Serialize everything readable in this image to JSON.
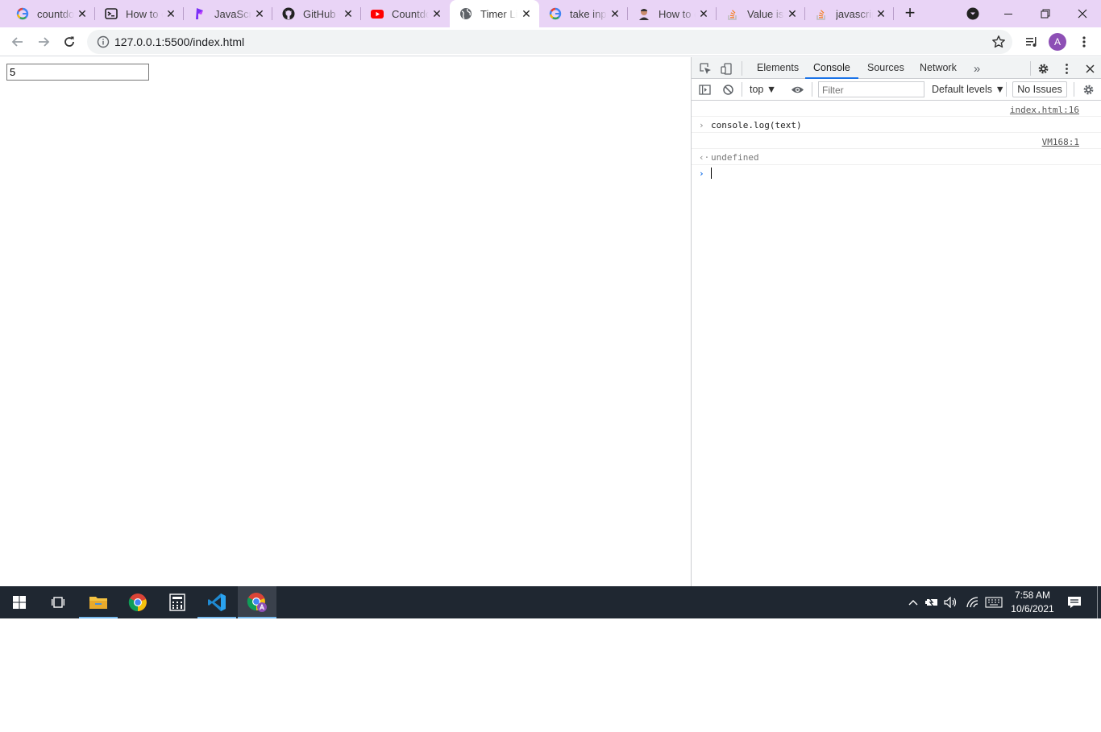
{
  "browser": {
    "tabs": [
      {
        "title": "countdown timer",
        "favicon": "google-icon",
        "active": false
      },
      {
        "title": "How to create",
        "favicon": "terminal-icon",
        "active": false
      },
      {
        "title": "JavaScript",
        "favicon": "p-logo-icon",
        "active": false
      },
      {
        "title": "GitHub - ",
        "favicon": "github-icon",
        "active": false
      },
      {
        "title": "Countdown",
        "favicon": "youtube-icon",
        "active": false
      },
      {
        "title": "Timer Lite",
        "favicon": "globe-icon",
        "active": true
      },
      {
        "title": "take input",
        "favicon": "google-icon",
        "active": false
      },
      {
        "title": "How to get",
        "favicon": "avatar-icon",
        "active": false
      },
      {
        "title": "Value is",
        "favicon": "stackoverflow-icon",
        "active": false
      },
      {
        "title": "javascript",
        "favicon": "stackoverflow-icon",
        "active": false
      }
    ],
    "close_glyph": "✕",
    "new_tab_glyph": "+",
    "url": "127.0.0.1:5500/index.html",
    "profile_initial": "A",
    "accent": "#e9d4f6"
  },
  "page": {
    "input_value": "5"
  },
  "devtools": {
    "tabs": [
      "Elements",
      "Console",
      "Sources",
      "Network"
    ],
    "more_tabs_glyph": "»",
    "context": "top ▼",
    "filter_placeholder": "Filter",
    "levels": "Default levels ▼",
    "issues": "No Issues",
    "console": {
      "rows": [
        {
          "kind": "source",
          "source": "index.html:16"
        },
        {
          "kind": "input",
          "prefix": "›",
          "text": "console.log(text)"
        },
        {
          "kind": "source",
          "source": "VM168:1"
        },
        {
          "kind": "result",
          "prefix": "‹·",
          "text": "undefined"
        }
      ],
      "prompt_glyph": "›"
    }
  },
  "taskbar": {
    "apps": [
      "start",
      "task-view",
      "file-explorer",
      "chrome",
      "calculator",
      "vscode",
      "chrome-profile"
    ],
    "tray_chevron": "^",
    "time": "7:58 AM",
    "date": "10/6/2021"
  }
}
